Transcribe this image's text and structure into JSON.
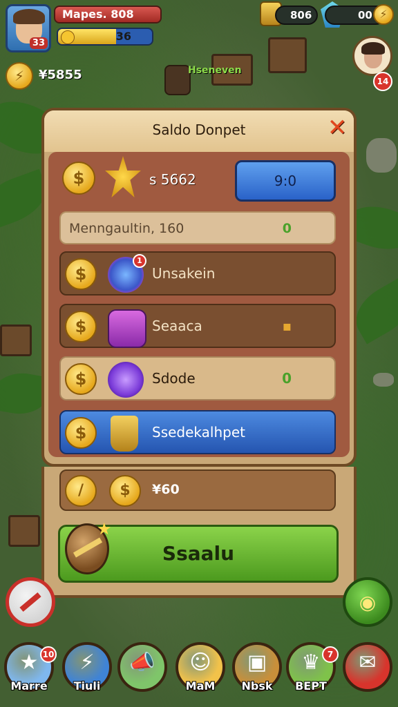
{
  "hud": {
    "level": "33",
    "player_name": "Mapes. 808",
    "xp_value": "36",
    "xp_fraction": 0.62,
    "currency_value": "¥5855",
    "gold_value": "806",
    "gem_value": "00",
    "side_badge": "14",
    "map_sign": "Hseneven"
  },
  "dialog": {
    "title": "Saldo Donpet",
    "close_icon": "close-icon",
    "top_row": {
      "label": "s 5662",
      "price_button": "9:0"
    },
    "info_row": {
      "label": "Menngaultin, 160",
      "value": "0"
    },
    "rows": [
      {
        "label": "Unsakein",
        "value": "",
        "icon": "blue-orb-icon",
        "badge": "1"
      },
      {
        "label": "Seaaca",
        "value": "▪",
        "icon": "gift-box-icon"
      },
      {
        "label": "Sdode",
        "value": "0",
        "icon": "purple-orb-icon"
      },
      {
        "label": "Ssedekalhpet",
        "value": "",
        "icon": "gold-trophy-icon"
      }
    ],
    "total_row": {
      "label": "¥60"
    },
    "action_button": "Ssaalu"
  },
  "bottom_nav": [
    {
      "label": "Marre",
      "badge": "10",
      "icon": "star-icon",
      "color": "#7fb7ee"
    },
    {
      "label": "Tiuli",
      "badge": "",
      "icon": "lightning-icon",
      "color": "#3f83d6"
    },
    {
      "label": "",
      "badge": "",
      "icon": "megaphone-icon",
      "color": "#7fc56a"
    },
    {
      "label": "MaM",
      "badge": "",
      "icon": "character-icon",
      "color": "#f2c24a"
    },
    {
      "label": "Nbsk",
      "badge": "",
      "icon": "treasure-chest-icon",
      "color": "#c98f3a"
    },
    {
      "label": "BEPT",
      "badge": "7",
      "icon": "trophy-icon",
      "color": "#7fc24a"
    },
    {
      "label": "",
      "badge": "",
      "icon": "chat-icon",
      "color": "#d8342c"
    }
  ],
  "colors": {
    "accent_green": "#6fbf34",
    "accent_blue": "#3a74d6",
    "panel_brown": "#7a4f30",
    "danger_red": "#d8342c"
  }
}
